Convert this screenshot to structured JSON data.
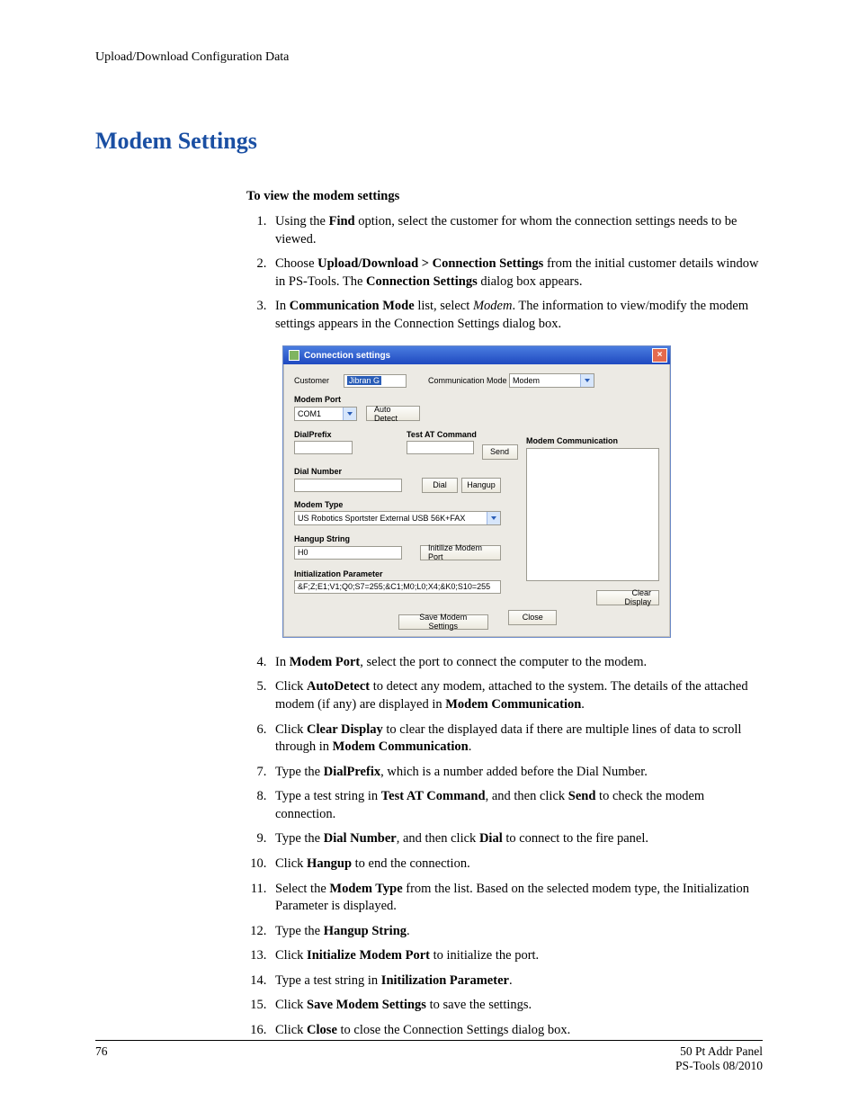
{
  "header": {
    "running_head": "Upload/Download Configuration Data"
  },
  "title": "Modem Settings",
  "intro": "To view the modem settings",
  "steps": {
    "s1a": "Using the ",
    "s1b": "Find",
    "s1c": " option, select the customer for whom the connection settings needs to be viewed.",
    "s2a": "Choose ",
    "s2b": "Upload/Download > Connection Settings",
    "s2c": " from the initial customer details window in PS-Tools. The ",
    "s2d": "Connection Settings",
    "s2e": " dialog box appears.",
    "s3a": "In ",
    "s3b": "Communication Mode",
    "s3c": " list, select ",
    "s3d": "Modem",
    "s3e": ". The information to view/modify the modem settings appears in the Connection Settings dialog box.",
    "s4a": "In ",
    "s4b": "Modem Port",
    "s4c": ", select the port to connect the computer to the modem.",
    "s5a": "Click ",
    "s5b": "AutoDetect",
    "s5c": " to detect any modem, attached to the system. The details of the attached modem (if any) are displayed in ",
    "s5d": "Modem Communication",
    "s5e": ".",
    "s6a": "Click ",
    "s6b": "Clear Display",
    "s6c": " to clear the displayed data if there are multiple lines of data to scroll through in ",
    "s6d": "Modem Communication",
    "s6e": ".",
    "s7a": "Type the ",
    "s7b": "DialPrefix",
    "s7c": ", which is a number added before the Dial Number.",
    "s8a": "Type a test string in ",
    "s8b": "Test AT Command",
    "s8c": ", and then click ",
    "s8d": "Send",
    "s8e": " to check the modem connection.",
    "s9a": "Type the ",
    "s9b": "Dial Number",
    "s9c": ", and then click ",
    "s9d": "Dial",
    "s9e": " to connect to the fire panel.",
    "s10a": "Click ",
    "s10b": "Hangup",
    "s10c": " to end the connection.",
    "s11a": "Select the ",
    "s11b": "Modem Type",
    "s11c": " from the list. Based on the selected modem type, the Initialization Parameter is displayed.",
    "s12a": "Type the ",
    "s12b": "Hangup String",
    "s12c": ".",
    "s13a": "Click ",
    "s13b": "Initialize Modem Port",
    "s13c": " to initialize the port.",
    "s14a": "Type a test string in ",
    "s14b": "Initilization Parameter",
    "s14c": ".",
    "s15a": "Click ",
    "s15b": "Save Modem Settings",
    "s15c": " to save the settings.",
    "s16a": "Click ",
    "s16b": "Close",
    "s16c": " to close the Connection Settings dialog box."
  },
  "dlg": {
    "title": "Connection settings",
    "labels": {
      "customer": "Customer",
      "comm_mode": "Communication Mode",
      "modem_port": "Modem Port",
      "dial_prefix": "DialPrefix",
      "test_at": "Test AT Command",
      "dial_number": "Dial Number",
      "modem_type": "Modem Type",
      "hangup_string": "Hangup String",
      "init_param": "Initialization Parameter",
      "modem_comm": "Modem Communication"
    },
    "values": {
      "customer": "Jibran G",
      "comm_mode": "Modem",
      "modem_port": "COM1",
      "modem_type": "US Robotics Sportster External USB 56K+FAX",
      "hangup_string": "H0",
      "init_param": "&F;Z;E1;V1;Q0;S7=255;&C1;M0;L0;X4;&K0;S10=255"
    },
    "buttons": {
      "auto_detect": "Auto Detect",
      "send": "Send",
      "dial": "Dial",
      "hangup": "Hangup",
      "init_port": "Initilize Modem  Port",
      "clear_display": "Clear Display",
      "save": "Save Modem Settings",
      "close": "Close"
    }
  },
  "footer": {
    "page": "76",
    "right1": "50 Pt Addr Panel",
    "right2": "PS-Tools 08/2010"
  }
}
